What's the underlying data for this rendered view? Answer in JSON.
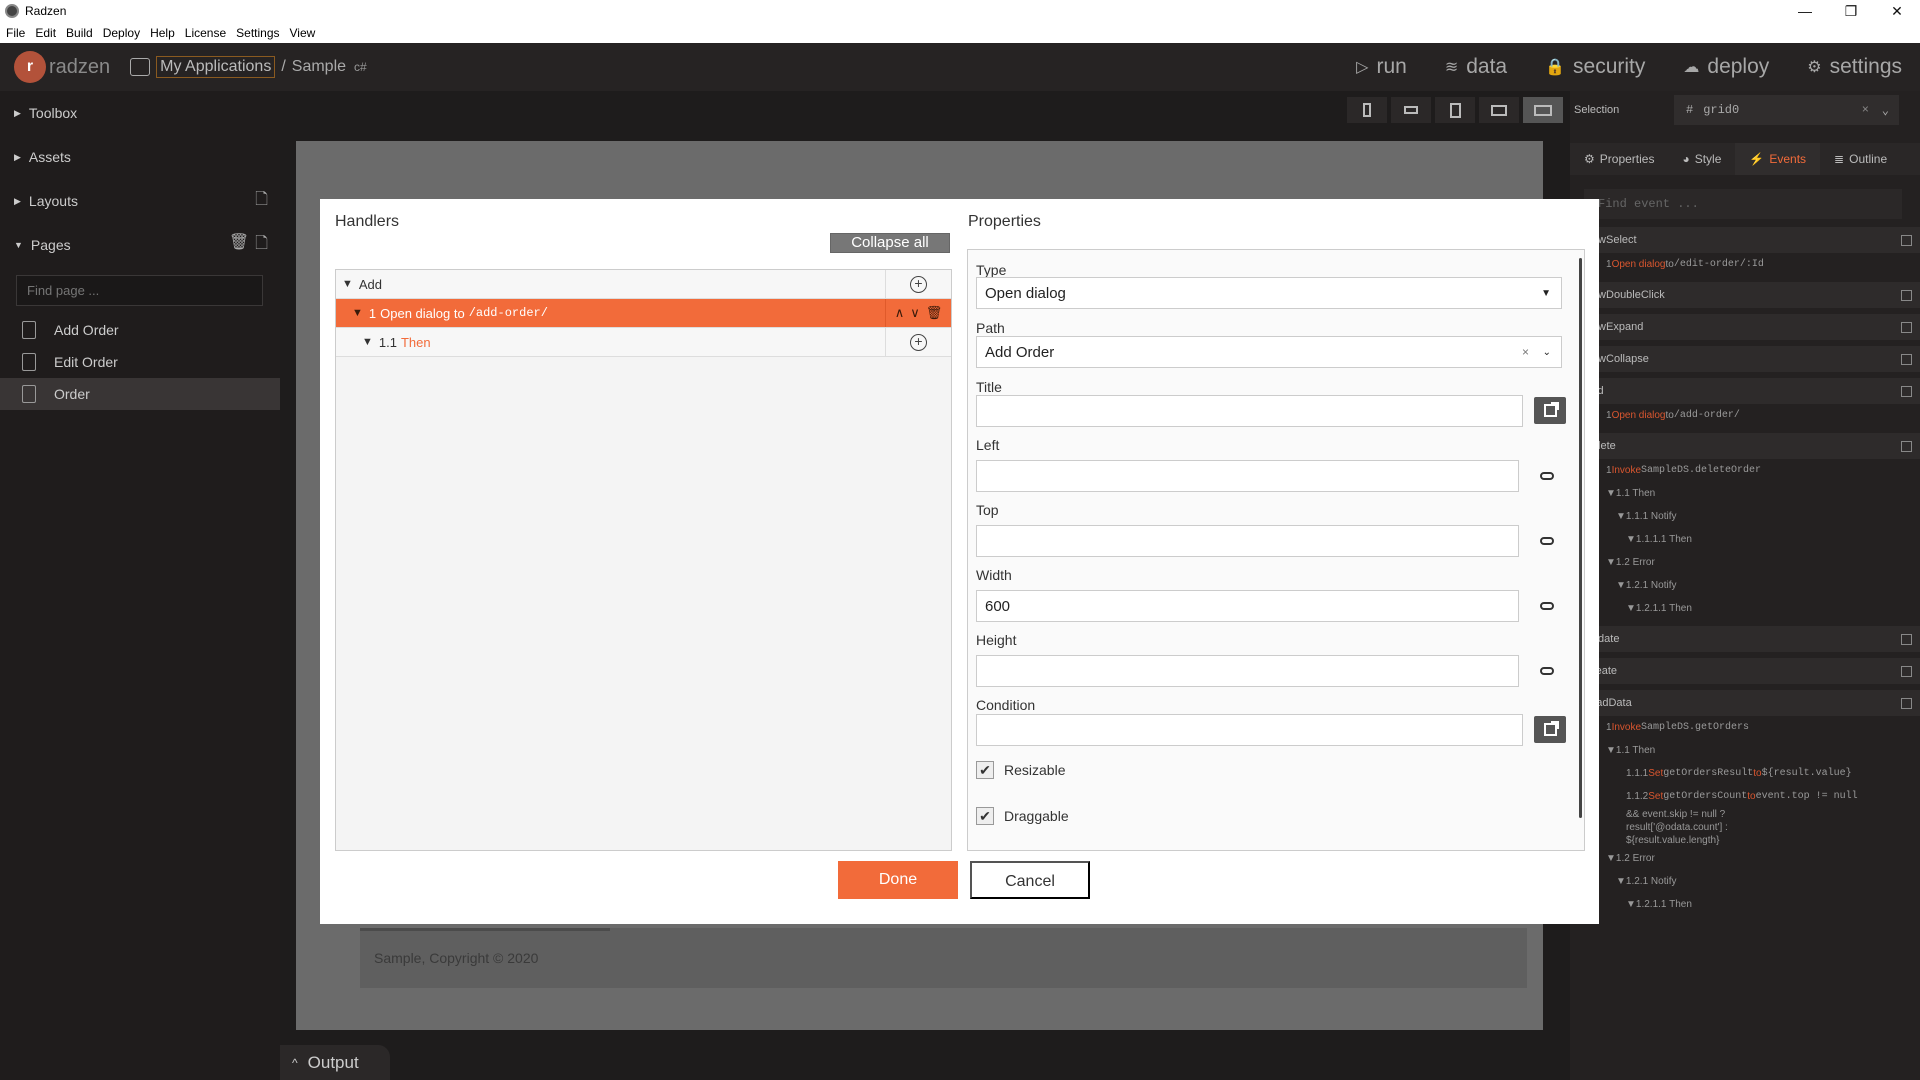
{
  "window": {
    "title": "Radzen",
    "minimize": "—",
    "maximize": "❐",
    "close": "✕"
  },
  "menubar": [
    "File",
    "Edit",
    "Build",
    "Deploy",
    "Help",
    "License",
    "Settings",
    "View"
  ],
  "topbar": {
    "logo_text": "radzen",
    "breadcrumb_apps": "My Applications",
    "breadcrumb_sep": "/",
    "breadcrumb_app": "Sample",
    "lang_badge": "c#",
    "actions": [
      {
        "label": "run",
        "icon": "▷"
      },
      {
        "label": "data",
        "icon": "≋"
      },
      {
        "label": "security",
        "icon": "🔒"
      },
      {
        "label": "deploy",
        "icon": "☁"
      },
      {
        "label": "settings",
        "icon": "⚙"
      }
    ]
  },
  "sidebar": {
    "sections": [
      {
        "label": "Toolbox",
        "caret": "▶"
      },
      {
        "label": "Assets",
        "caret": "▶"
      },
      {
        "label": "Layouts",
        "caret": "▶"
      },
      {
        "label": "Pages",
        "caret": "▼"
      }
    ],
    "find_placeholder": "Find page ...",
    "pages": [
      "Add Order",
      "Edit Order",
      "Order"
    ]
  },
  "canvas": {
    "footer_text": "Sample, Copyright © 2020",
    "output_tab": "Output"
  },
  "right_panel": {
    "selection_label": "Selection",
    "selection_value": "grid0",
    "selection_hash": "#",
    "tabs": [
      {
        "label": "Properties",
        "icon": "⚙"
      },
      {
        "label": "Style",
        "icon": "◕"
      },
      {
        "label": "Events",
        "icon": "⚡"
      },
      {
        "label": "Outline",
        "icon": "≣"
      }
    ],
    "find_event_placeholder": "Find event ...",
    "events": {
      "row_select": "RowSelect",
      "row_select_action": [
        "1 ",
        "Open dialog",
        " to ",
        "/edit-order/:Id"
      ],
      "row_double_click": "RowDoubleClick",
      "row_expand": "RowExpand",
      "row_collapse": "RowCollapse",
      "add": "Add",
      "add_action": [
        "1 ",
        "Open dialog",
        " to ",
        "/add-order/"
      ],
      "delete": "Delete",
      "delete_action": [
        "1 ",
        "Invoke",
        " ",
        "SampleDS.deleteOrder"
      ],
      "delete_then": "1.1 Then",
      "delete_notify": "1.1.1 Notify",
      "delete_notify_then": "1.1.1.1 Then",
      "delete_error": "1.2 Error",
      "delete_error_notify": "1.2.1 Notify",
      "delete_error_notify_then": "1.2.1.1 Then",
      "update": "Update",
      "create": "Create",
      "load_data": "LoadData",
      "load_action": [
        "1 ",
        "Invoke",
        " ",
        "SampleDS.getOrders"
      ],
      "load_then": "1.1 Then",
      "load_set1": [
        "1.1.1 ",
        "Set",
        " getOrdersResult ",
        "to",
        " ${result.value}"
      ],
      "load_set2": [
        "1.1.2 ",
        "Set",
        " getOrdersCount ",
        "to",
        " event.top != null"
      ],
      "load_set2_cont1": "&& event.skip != null ?",
      "load_set2_cont2": "result['@odata.count'] :",
      "load_set2_cont3": "${result.value.length}",
      "load_error": "1.2 Error",
      "load_error_notify": "1.2.1 Notify",
      "load_error_notify_then": "1.2.1.1 Then"
    }
  },
  "dialog": {
    "handlers_title": "Handlers",
    "collapse_all": "Collapse all",
    "handler_add": "Add",
    "handler_1_num": "1",
    "handler_1_type": "Open dialog to",
    "handler_1_path": "/add-order/",
    "handler_11_num": "1.1",
    "handler_11_then": "Then",
    "properties_title": "Properties",
    "type_label": "Type",
    "type_value": "Open dialog",
    "path_label": "Path",
    "path_value": "Add Order",
    "title_label": "Title",
    "title_value": "",
    "left_label": "Left",
    "left_value": "",
    "top_label": "Top",
    "top_value": "",
    "width_label": "Width",
    "width_value": "600",
    "height_label": "Height",
    "height_value": "",
    "condition_label": "Condition",
    "condition_value": "",
    "resizable_label": "Resizable",
    "resizable_checked": true,
    "draggable_label": "Draggable",
    "draggable_checked": true,
    "done_label": "Done",
    "cancel_label": "Cancel"
  },
  "colors": {
    "accent": "#f26b3a",
    "bg": "#1e1c1c"
  }
}
